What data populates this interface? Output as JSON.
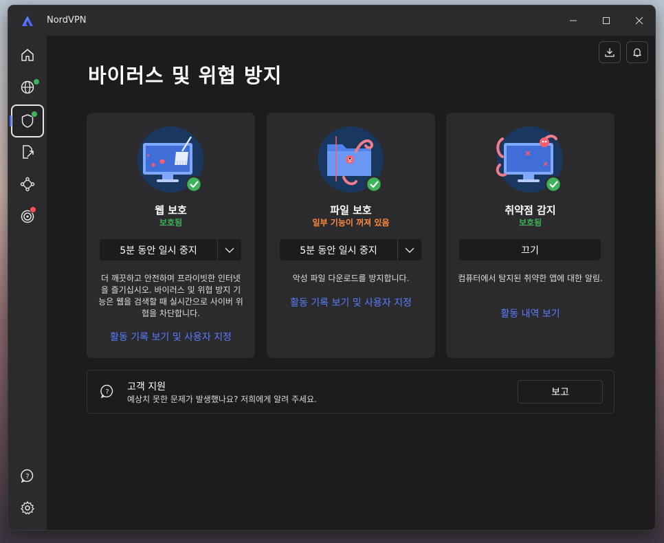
{
  "window": {
    "title": "NordVPN"
  },
  "page": {
    "title": "바이러스 및 위협 방지"
  },
  "sidebar": {
    "items": [
      {
        "name": "home-icon"
      },
      {
        "name": "globe-icon"
      },
      {
        "name": "shield-icon"
      },
      {
        "name": "share-file-icon"
      },
      {
        "name": "meshnet-icon"
      },
      {
        "name": "target-icon"
      },
      {
        "name": "help-icon"
      },
      {
        "name": "settings-icon"
      }
    ]
  },
  "colors": {
    "accent": "#4b6bff",
    "link": "#5a7dff",
    "ok": "#3eb35a",
    "warn": "#ff8a3d",
    "alert": "#ff4d5a"
  },
  "cards": [
    {
      "title": "웹 보호",
      "status": "보호됨",
      "status_color": "#3eb35a",
      "button": "5분 동안 일시 중지",
      "description": "더 깨끗하고 안전하며 프라이빗한 인터넷을 즐기십시오. 바이러스 및 위협 방지 기능은 웹을 검색할 때 실시간으로 사이버 위협을 차단합니다.",
      "link": "활동 기록 보기 및 사용자 지정"
    },
    {
      "title": "파일 보호",
      "status": "일부 기능이 꺼져 있음",
      "status_color": "#ff8a3d",
      "button": "5분 동안 일시 중지",
      "description": "악성 파일 다운로드를 방지합니다.",
      "link": "활동 기록 보기 및 사용자 지정"
    },
    {
      "title": "취약점 감지",
      "status": "보호됨",
      "status_color": "#3eb35a",
      "button": "끄기",
      "description": "컴퓨터에서 탐지된 취약한 앱에 대한 알림.",
      "link": "활동 내역 보기"
    }
  ],
  "support": {
    "title": "고객 지원",
    "text": "예상치 못한 문제가 발생했나요? 저희에게 알려 주세요.",
    "button": "보고"
  }
}
